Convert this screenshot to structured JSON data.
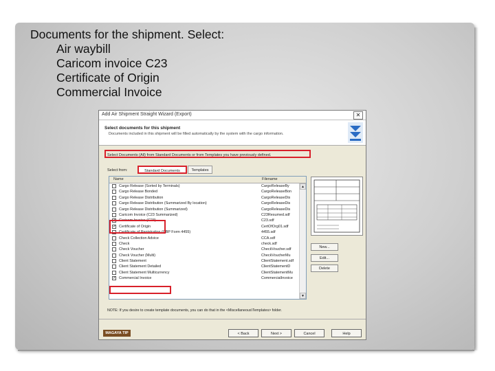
{
  "slide": {
    "lines": [
      "Documents for the shipment. Select:",
      "Air waybill",
      "Caricom invoice C23",
      "Certificate of Origin",
      "Commercial Invoice"
    ]
  },
  "wizard": {
    "title": "Add Air Shipment Straight Wizard (Export)",
    "close_label": "✕",
    "header_title": "Select documents for this shipment",
    "header_subtitle": "Documents included in this shipment will be filled automatically by the system with the cargo information.",
    "instruction": "Select Documents (All) from Standard Documents or from Templates you have previously defined.",
    "select_from_label": "Select from:",
    "tabs": [
      "Standard Documents",
      "Templates"
    ],
    "list_headers": [
      "Name",
      "Filename"
    ],
    "rows": [
      {
        "name": "Cargo Release (Sorted by Terminals)",
        "file": "CargoReleaseBy",
        "checked": false
      },
      {
        "name": "Cargo Release Bonded",
        "file": "CargoReleaseBon",
        "checked": false
      },
      {
        "name": "Cargo Release Distribution",
        "file": "CargoReleaseDis",
        "checked": false
      },
      {
        "name": "Cargo Release Distribution (Summarized By location)",
        "file": "CargoReleaseDis",
        "checked": false
      },
      {
        "name": "Cargo Release Distribution (Summarized)",
        "file": "CargoReleaseDis",
        "checked": false
      },
      {
        "name": "Caricom Invoice (C23 Summarized)",
        "file": "C23Resumed.sdf",
        "checked": false
      },
      {
        "name": "Caricom Invoice (C23)",
        "file": "C23.sdf",
        "checked": true
      },
      {
        "name": "Certificate of Origin",
        "file": "CertOfOrg01.sdf",
        "checked": true
      },
      {
        "name": "Certificate of Registration (CBP Form 4455)",
        "file": "4455.sdf",
        "checked": false
      },
      {
        "name": "Check Collection Advice",
        "file": "CCA.sdf",
        "checked": false
      },
      {
        "name": "Check",
        "file": "check.sdf",
        "checked": false
      },
      {
        "name": "Check Voucher",
        "file": "CheckVoucher.sdf",
        "checked": false
      },
      {
        "name": "Check Voucher (Multi)",
        "file": "CheckVoucherMu",
        "checked": false
      },
      {
        "name": "Client Statement",
        "file": "ClientStatement.sdf",
        "checked": false
      },
      {
        "name": "Client Statement Detailed",
        "file": "ClientStatementD",
        "checked": false
      },
      {
        "name": "Client Statement Multicurrency",
        "file": "ClientStatementMu",
        "checked": false
      },
      {
        "name": "Commercial Invoice",
        "file": "CommercialInvoice",
        "checked": true
      }
    ],
    "side_buttons": [
      "New...",
      "Edit...",
      "Delete"
    ],
    "note": "NOTE: If you desire to create template documents, you can do that in the <Miscellaneous\\Templates> folder.",
    "magaya_tip": "MAGAYA TIP",
    "footer_buttons": [
      "< Back",
      "Next >",
      "Cancel",
      "Help"
    ],
    "scroll_up": "▲",
    "scroll_down": "▼",
    "colors": {
      "highlight": "#d8202a",
      "dialog_bg": "#ece9d8",
      "tip_bg": "#7a4d22"
    }
  }
}
